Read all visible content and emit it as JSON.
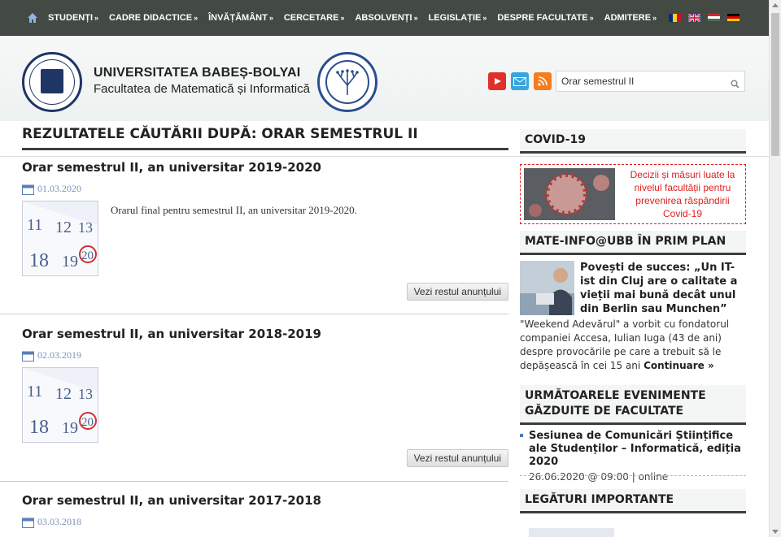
{
  "nav": {
    "items": [
      {
        "label": "STUDENȚI",
        "arrow": "»"
      },
      {
        "label": "CADRE DIDACTICE",
        "arrow": "»"
      },
      {
        "label": "ÎNVĂȚĂMÂNT",
        "arrow": "»"
      },
      {
        "label": "CERCETARE",
        "arrow": "»"
      },
      {
        "label": "ABSOLVENȚI",
        "arrow": "»"
      },
      {
        "label": "LEGISLAȚIE",
        "arrow": "»"
      },
      {
        "label": "DESPRE FACULTATE",
        "arrow": "»"
      },
      {
        "label": "ADMITERE",
        "arrow": "»"
      }
    ],
    "flags": [
      "romanian-flag-icon",
      "uk-flag-icon",
      "hungarian-flag-icon",
      "german-flag-icon"
    ]
  },
  "header": {
    "university": "UNIVERSITATEA BABEȘ-BOLYAI",
    "faculty": "Facultatea de Matematică și Informatică",
    "search_value": "Orar semestrul II"
  },
  "main": {
    "title": "REZULTATELE CĂUTĂRII DUPĂ: ORAR SEMESTRUL II",
    "articles": [
      {
        "title": "Orar semestrul II, an universitar 2019-2020",
        "date": "01.03.2020",
        "text": "Orarul final pentru semestrul II, an universitar 2019-2020.",
        "more": "Vezi restul anunțului"
      },
      {
        "title": "Orar semestrul II, an universitar 2018-2019",
        "date": "02.03.2019",
        "text": "",
        "more": "Vezi restul anunțului"
      },
      {
        "title": "Orar semestrul II, an universitar 2017-2018",
        "date": "03.03.2018",
        "text": "",
        "more": ""
      }
    ]
  },
  "sidebar": {
    "covid": {
      "heading": "COVID-19",
      "text": "Decizii și măsuri luate la nivelul facultății pentru prevenirea răspândirii Covid-19"
    },
    "mateinfo": {
      "heading": "MATE-INFO@UBB ÎN PRIM PLAN",
      "title": "Povești de succes: „Un IT-ist din Cluj are o calitate a vieții mai bună decât unul din Berlin sau Munchen”",
      "text": "\"Weekend Adevărul\" a vorbit cu fondatorul companiei Accesa, Iulian Iuga (43 de ani) despre provocările pe care a trebuit să le depășească în cei 15 ani",
      "more": "Continuare »"
    },
    "events": {
      "heading": "URMĂTOARELE EVENIMENTE GĂZDUITE DE FACULTATE",
      "items": [
        {
          "title": "Sesiunea de Comunicări Științifice ale Studenților – Informatică, ediția 2020",
          "meta": "26.06.2020 @ 09:00 | online"
        }
      ]
    },
    "links": {
      "heading": "LEGĂTURI IMPORTANTE"
    }
  },
  "colors": {
    "nav_bg": "#434a43",
    "accent_red": "#e02020",
    "date_blue": "#7a92b8"
  }
}
